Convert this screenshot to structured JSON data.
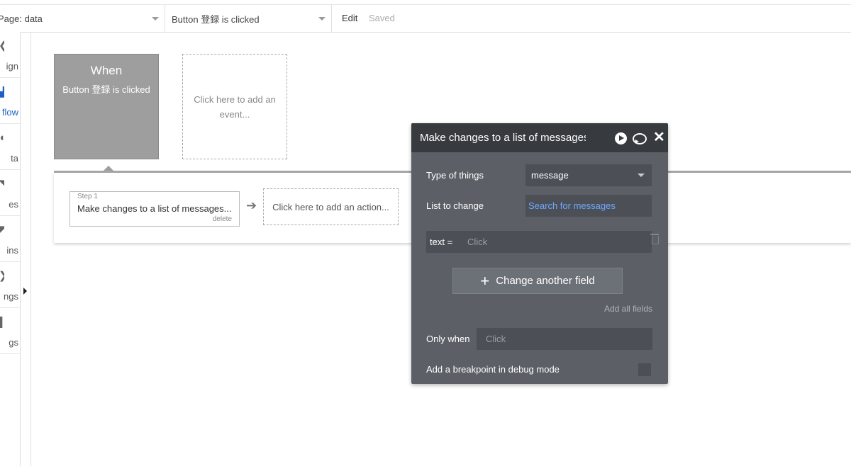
{
  "topbar": {
    "page_dropdown": "Page: data",
    "event_dropdown": "Button 登録 is clicked",
    "edit": "Edit",
    "saved": "Saved"
  },
  "sidebar": {
    "items": [
      {
        "label": "ign",
        "icon": "design-icon"
      },
      {
        "label": "flow",
        "icon": "workflow-icon",
        "active": true
      },
      {
        "label": "ta",
        "icon": "data-icon"
      },
      {
        "label": "es",
        "icon": "styles-icon"
      },
      {
        "label": "ins",
        "icon": "plugins-icon"
      },
      {
        "label": "ngs",
        "icon": "settings-icon"
      },
      {
        "label": "gs",
        "icon": "logs-icon"
      }
    ]
  },
  "event": {
    "when_title": "When",
    "when_subtitle": "Button 登録 is clicked",
    "add_event": "Click here to add an event..."
  },
  "actions": {
    "step_number": "Step 1",
    "step_name": "Make changes to a list of messages...",
    "delete": "delete",
    "add_action": "Click here to add an action..."
  },
  "panel": {
    "title": "Make changes to a list of messages",
    "type_label": "Type of things",
    "type_value": "message",
    "list_label": "List to change",
    "list_value": "Search for messages",
    "field_key": "text =",
    "field_placeholder": "Click",
    "change_another": "Change another field",
    "add_all": "Add all fields",
    "only_when_label": "Only when",
    "only_when_placeholder": "Click",
    "breakpoint_label": "Add a breakpoint in debug mode"
  },
  "colors": {
    "panel_bg": "#5c6066",
    "panel_header": "#373a3f",
    "link_blue": "#6fa8ff",
    "sidebar_active": "#1f5fc4",
    "event_card": "#9e9e9e"
  }
}
